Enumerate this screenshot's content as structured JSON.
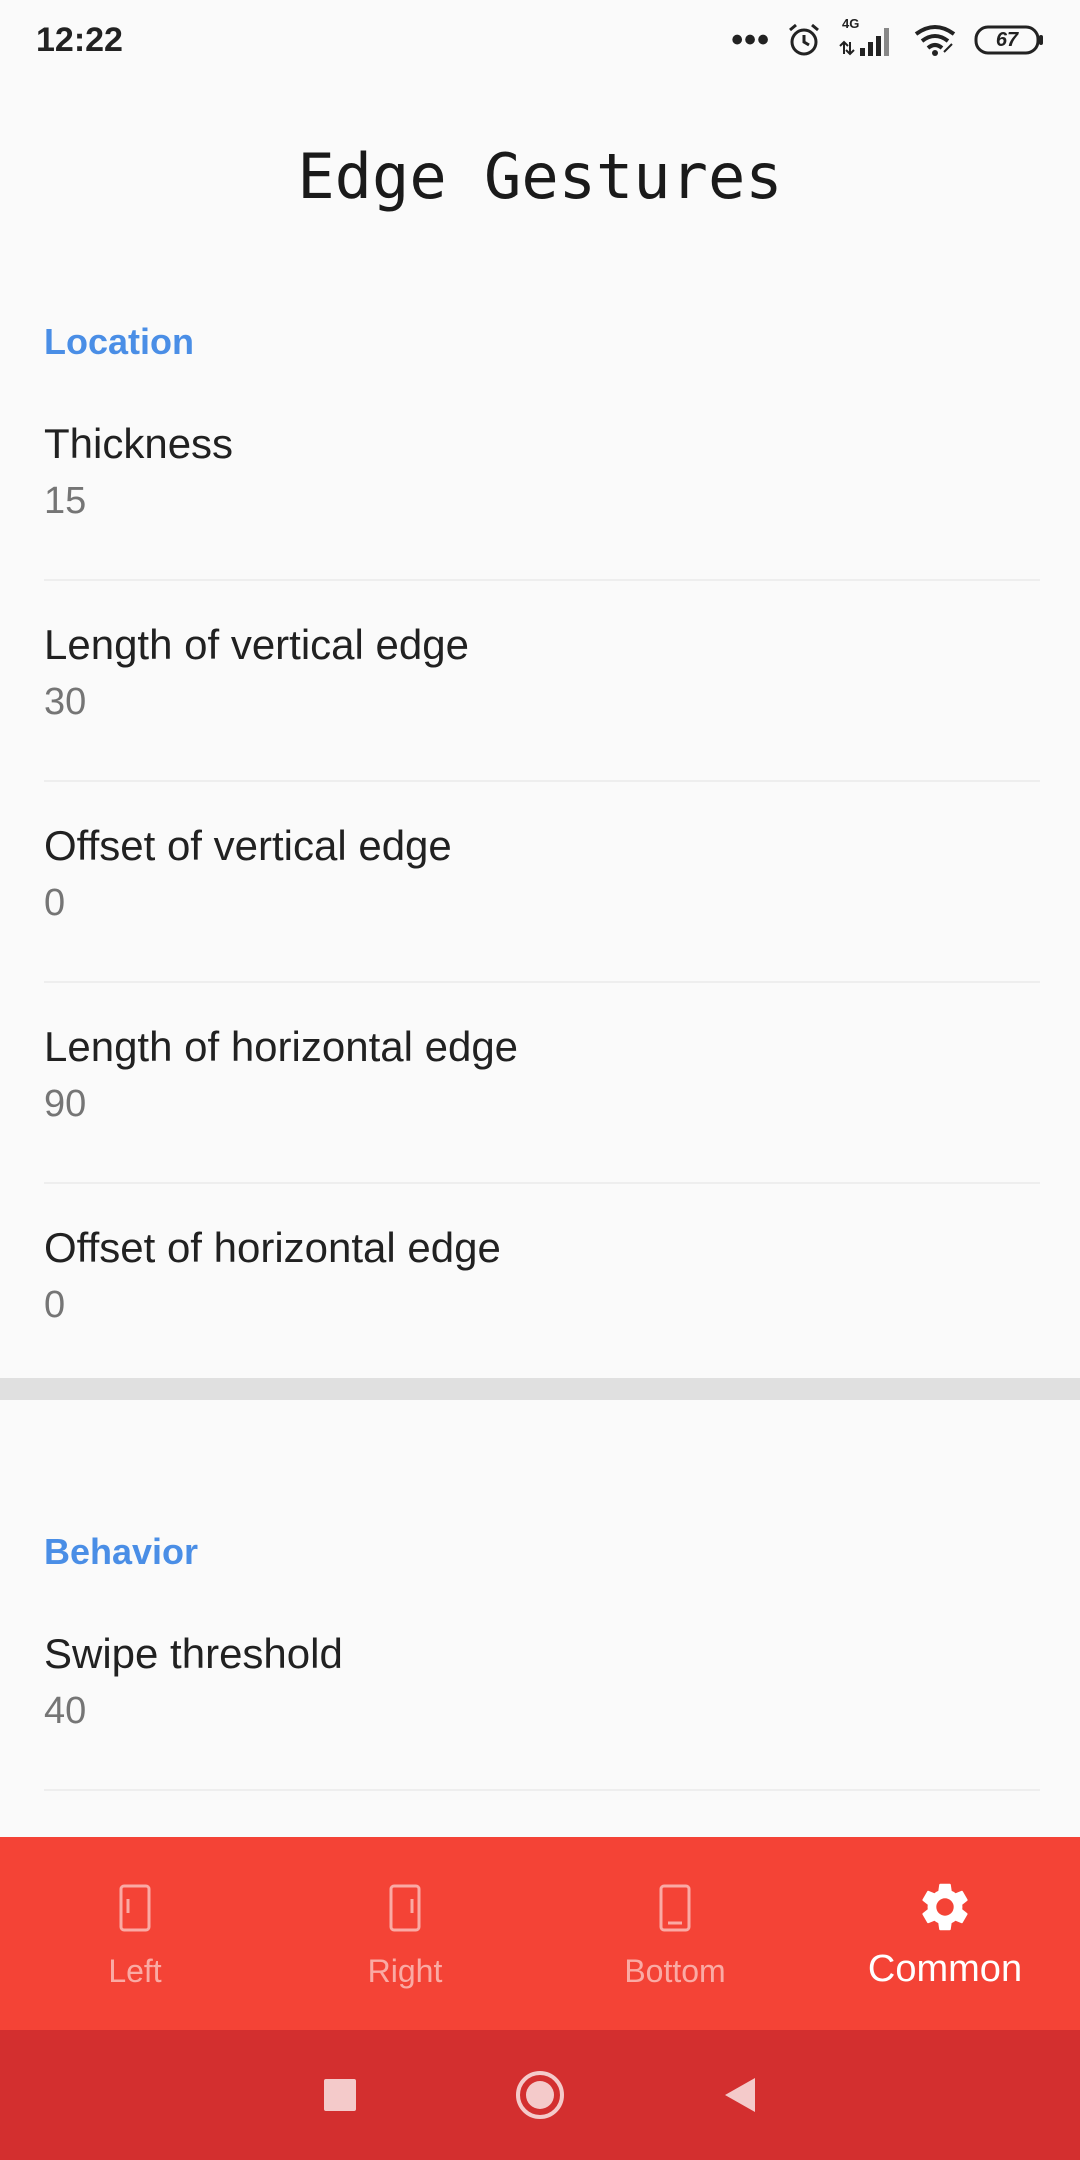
{
  "status_bar": {
    "time": "12:22",
    "dots": "•••",
    "network": "4G",
    "battery": "67"
  },
  "app": {
    "title": "Edge Gestures"
  },
  "sections": {
    "location": {
      "header": "Location",
      "items": [
        {
          "title": "Thickness",
          "value": "15"
        },
        {
          "title": "Length of vertical edge",
          "value": "30"
        },
        {
          "title": "Offset of vertical edge",
          "value": "0"
        },
        {
          "title": "Length of horizontal edge",
          "value": "90"
        },
        {
          "title": "Offset of horizontal edge",
          "value": "0"
        }
      ]
    },
    "behavior": {
      "header": "Behavior",
      "items": [
        {
          "title": "Swipe threshold",
          "value": "40"
        }
      ]
    }
  },
  "bottom_nav": {
    "items": [
      {
        "label": "Left",
        "icon": "phone-left-edge-icon",
        "active": false
      },
      {
        "label": "Right",
        "icon": "phone-right-edge-icon",
        "active": false
      },
      {
        "label": "Bottom",
        "icon": "phone-bottom-edge-icon",
        "active": false
      },
      {
        "label": "Common",
        "icon": "gear-icon",
        "active": true
      }
    ]
  },
  "colors": {
    "accent": "#4a8ee6",
    "nav_bg": "#f44336",
    "system_nav_bg": "#d32f2f"
  }
}
